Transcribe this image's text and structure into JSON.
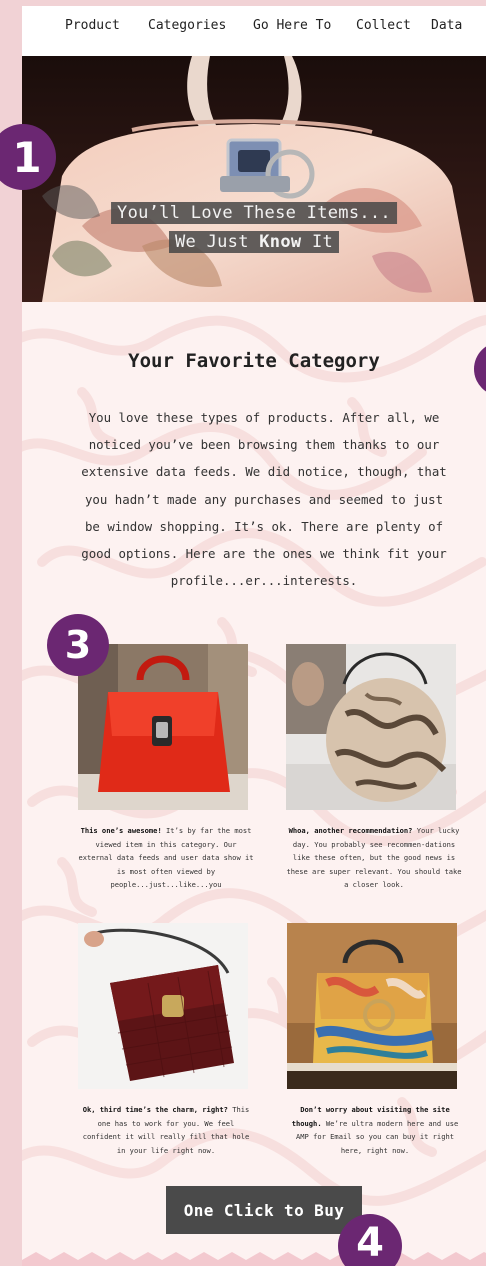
{
  "nav": {
    "items": [
      "Product",
      "Categories",
      "Go Here To",
      "Collect",
      "Data"
    ]
  },
  "hero": {
    "line1": "You’ll Love These Items...",
    "line2_prefix": "We Just ",
    "line2_bold": "Know",
    "line2_suffix": " It"
  },
  "section": {
    "title": "Your Favorite Category",
    "intro": "You love these types of products. After all, we noticed you’ve been browsing them thanks to our extensive data feeds. We did notice, though, that you hadn’t made any purchases and seemed to just be window shopping. It’s ok. There are plenty of good options. Here are the ones we think fit your profile...er...interests."
  },
  "products": [
    {
      "bold": "This one’s awesome!",
      "text": " It’s by far the most viewed item in this category. Our external data feeds and user data show it is most often viewed by people...just...like...you"
    },
    {
      "bold": "Whoa, another recommendation?",
      "text": " Your lucky day. You probably see recommen-dations like these often, but the good news is these are super relevant. You should take a closer look."
    },
    {
      "bold": "Ok, third time’s the charm, right?",
      "text": " This one has to work for you. We feel confident it will really fill that hole in your life right now."
    },
    {
      "bold": "Don’t worry about visiting the site though.",
      "text": " We’re ultra modern here and use AMP for Email so you can buy it right here, right now."
    }
  ],
  "cta": {
    "label": "One Click to Buy"
  },
  "badges": [
    "1",
    "3",
    "4"
  ],
  "colors": {
    "badge": "#6b2772",
    "page_bg": "#f1d2d5",
    "content_bg": "#fdf2f1",
    "button": "#4a4a4a"
  }
}
